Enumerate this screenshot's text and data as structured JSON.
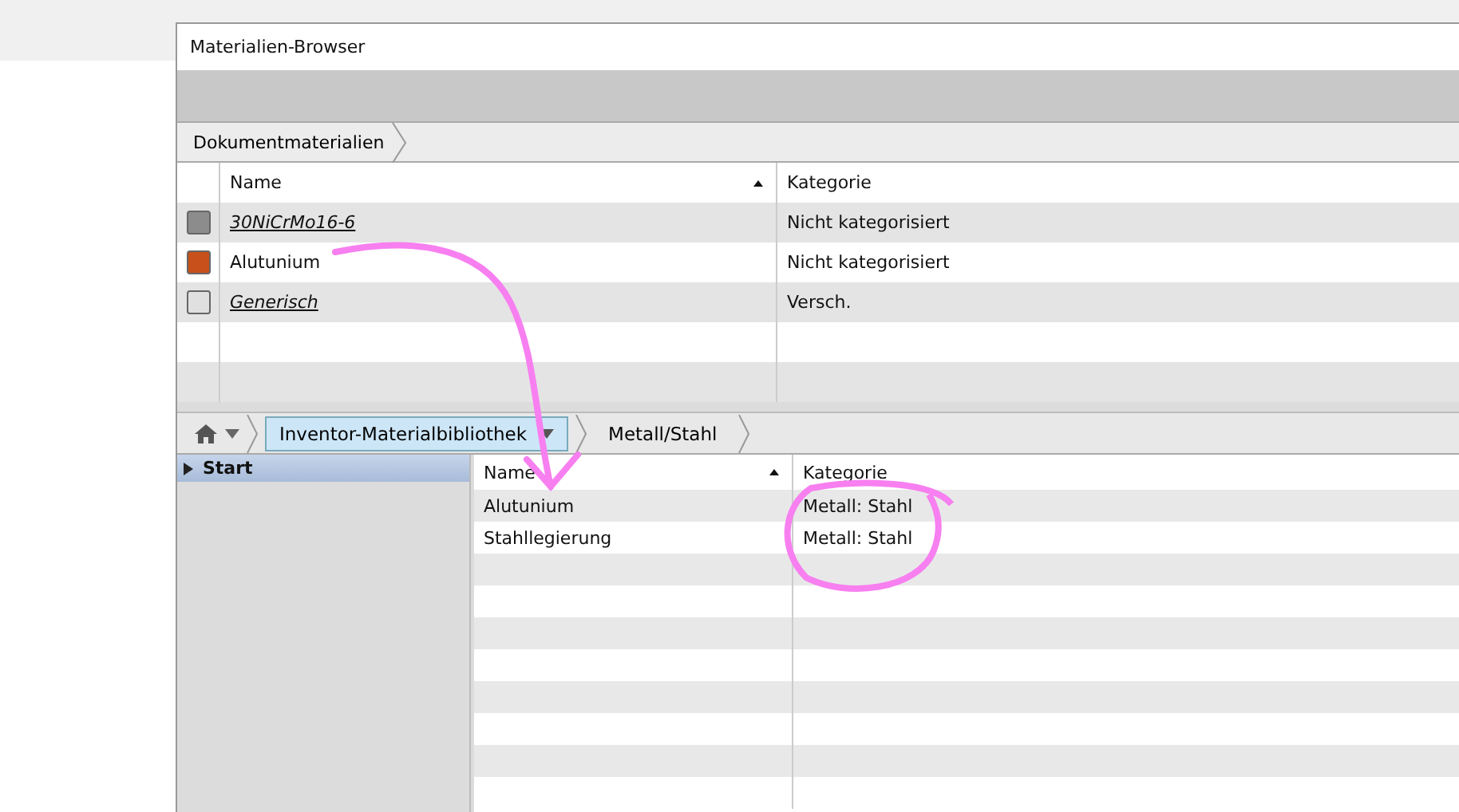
{
  "window": {
    "title": "Materialien-Browser"
  },
  "document_breadcrumb": [
    "Dokumentmaterialien"
  ],
  "document_table": {
    "columns": [
      {
        "label": "Name",
        "sorted": true
      },
      {
        "label": "Kategorie",
        "sorted": false
      }
    ],
    "rows": [
      {
        "name": "30NiCrMo16-6",
        "category": "Nicht kategorisiert",
        "linked": true,
        "color": "#8c8c8c"
      },
      {
        "name": "Alutunium",
        "category": "Nicht kategorisiert",
        "linked": false,
        "color": "#c8501a"
      },
      {
        "name": "Generisch",
        "category": "Versch.",
        "linked": true,
        "color": "#e0e0e0"
      }
    ]
  },
  "library_breadcrumb": [
    {
      "label": "Inventor-Materialbibliothek",
      "selected": true,
      "dropdown": true
    },
    {
      "label": "Metall/Stahl",
      "selected": false,
      "dropdown": false
    }
  ],
  "tree": [
    {
      "label": "Start",
      "selected": true
    }
  ],
  "library_table": {
    "columns": [
      {
        "label": "Name",
        "sorted": true
      },
      {
        "label": "Kategorie",
        "sorted": false
      }
    ],
    "rows": [
      {
        "name": "Alutunium",
        "category": "Metall: Stahl"
      },
      {
        "name": "Stahllegierung",
        "category": "Metall: Stahl"
      }
    ]
  }
}
